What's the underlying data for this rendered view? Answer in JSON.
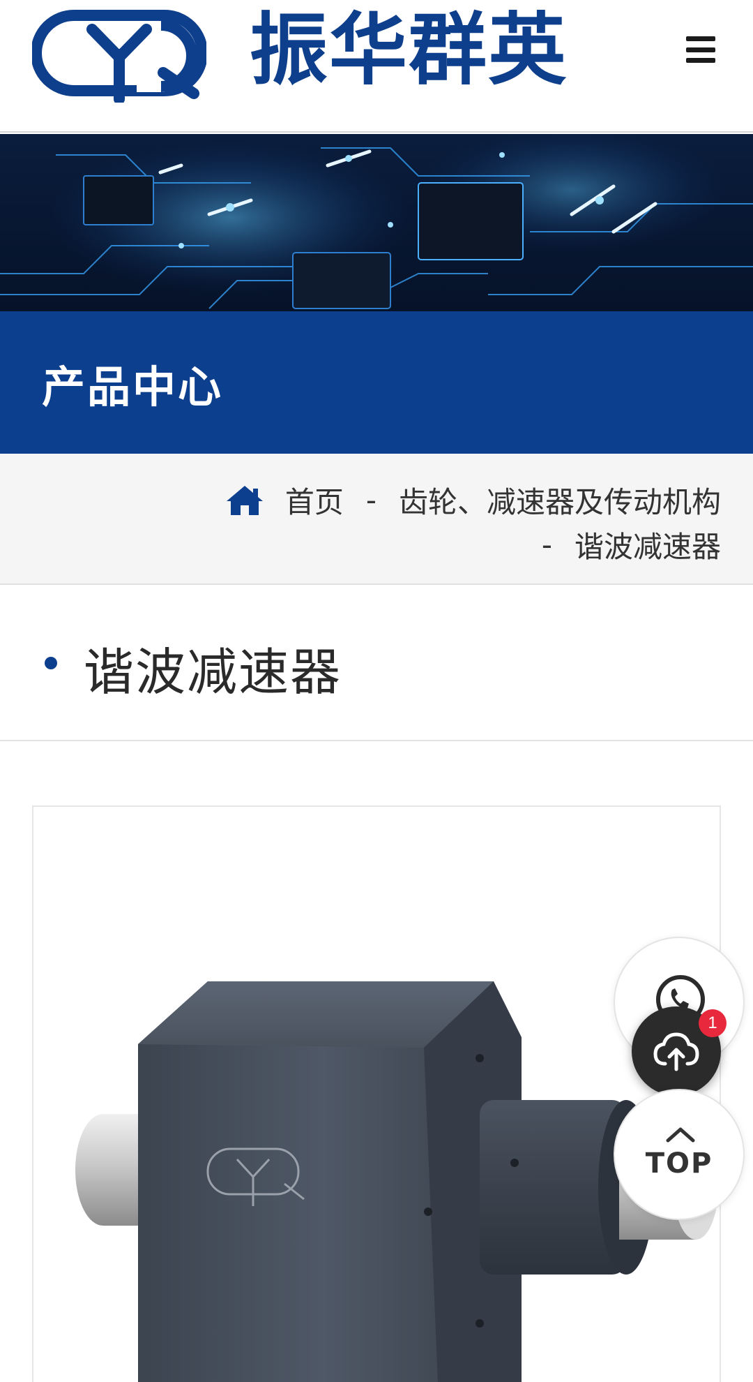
{
  "header": {
    "brand": "振华群英",
    "logo_letters": "YQ",
    "logo_icon": "yq-logo-icon",
    "menu_icon": "hamburger-menu-icon"
  },
  "banner": {
    "image": "circuit-board-banner"
  },
  "section": {
    "title": "产品中心"
  },
  "breadcrumb": {
    "home_icon": "home-icon",
    "items": [
      "首页",
      "齿轮、减速器及传动机构",
      "谐波减速器"
    ],
    "separator": "-"
  },
  "category": {
    "title": "谐波减速器"
  },
  "product": {
    "image": "harmonic-reducer-product-image"
  },
  "floating": {
    "contact_icon": "phone-icon",
    "upload_icon": "cloud-upload-icon",
    "upload_badge": "1",
    "top_label": "TOP"
  },
  "colors": {
    "brand_blue": "#0d3f8f",
    "logo_blue": "#0e3f8c",
    "badge_red": "#e8283c"
  }
}
